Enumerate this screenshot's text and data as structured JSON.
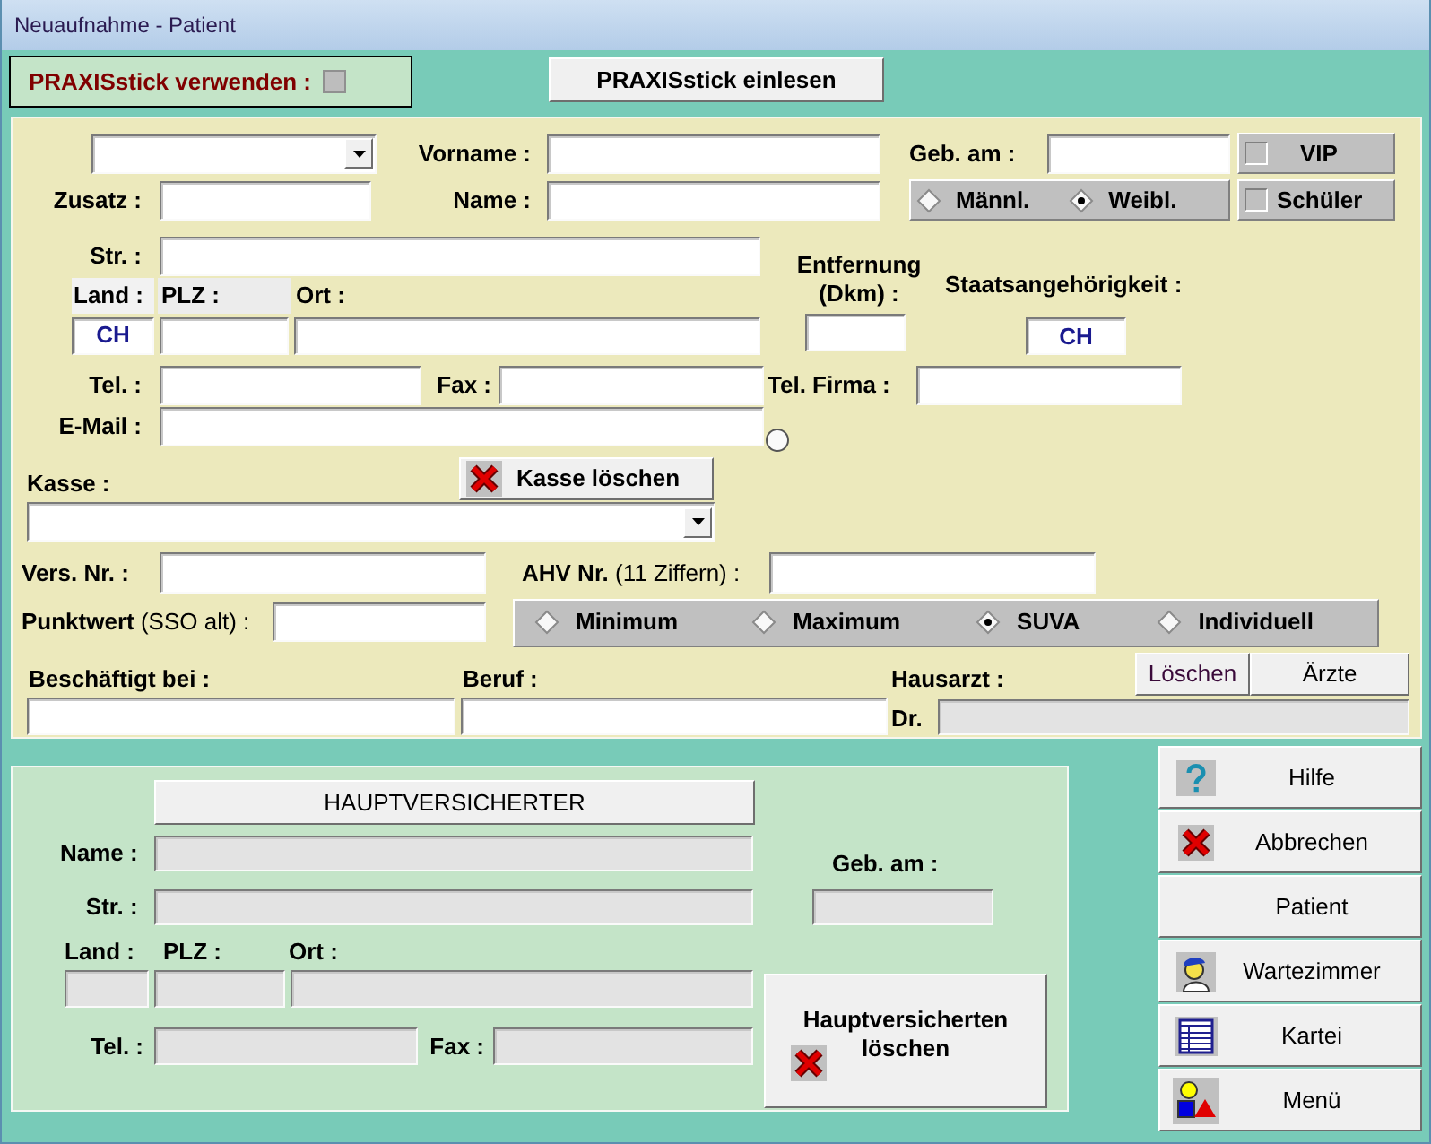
{
  "window": {
    "title": "Neuaufnahme - Patient"
  },
  "praxisstick": {
    "label": "PRAXISstick verwenden :",
    "checked": false
  },
  "read_button": "PRAXISstick einlesen",
  "patient": {
    "vorname": "Vorname :",
    "zusatz": "Zusatz :",
    "name": "Name :",
    "birth": "Geb. am :",
    "vip": {
      "label": "VIP",
      "checked": false
    },
    "schueler": {
      "label": "Schüler",
      "checked": false
    },
    "gender": [
      {
        "label": "Männl.",
        "selected": false
      },
      {
        "label": "Weibl.",
        "selected": true
      }
    ],
    "street": "Str. :",
    "land": {
      "label": "Land :",
      "value": "CH"
    },
    "plz": "PLZ :",
    "ort": "Ort :",
    "distance": "Entfernung (Dkm) :",
    "nationality": {
      "label": "Staatsangehörigkeit :",
      "value": "CH"
    },
    "tel": "Tel. :",
    "fax": "Fax :",
    "tel_firma": "Tel. Firma :",
    "email": {
      "label": "E-Mail :",
      "selected": false
    },
    "kasse": "Kasse :",
    "kasse_clear": "Kasse löschen",
    "vers_nr": "Vers. Nr. :",
    "ahv": "**AHV Nr.** (11 Ziffern) :",
    "punktwert": "**Punktwert** (SSO alt) :",
    "tariff": [
      {
        "label": "Minimum",
        "selected": false
      },
      {
        "label": "Maximum",
        "selected": false
      },
      {
        "label": "SUVA",
        "selected": true
      },
      {
        "label": "Individuell",
        "selected": false
      }
    ],
    "employer": "Beschäftigt bei :",
    "job": "Beruf :",
    "doctor": "Hausarzt :",
    "doctor_prefix": "Dr.",
    "doctor_buttons": [
      "Löschen",
      "Ärzte"
    ]
  },
  "main_insured": {
    "title": "HAUPTVERSICHERTER",
    "name": "Name :",
    "street": "Str. :",
    "birth": "Geb. am :",
    "land": "Land :",
    "plz": "PLZ :",
    "ort": "Ort :",
    "tel": "Tel. :",
    "fax": "Fax :",
    "delete_button": "Hauptversicherten löschen"
  },
  "actions": [
    {
      "label": "Hilfe",
      "kind": "help"
    },
    {
      "label": "Abbrechen",
      "kind": "cancel"
    },
    {
      "label": "Patient",
      "kind": "plain"
    },
    {
      "label": "Wartezimmer",
      "kind": "waiting"
    },
    {
      "label": "Kartei",
      "kind": "file"
    },
    {
      "label": "Menü",
      "kind": "menu"
    }
  ]
}
